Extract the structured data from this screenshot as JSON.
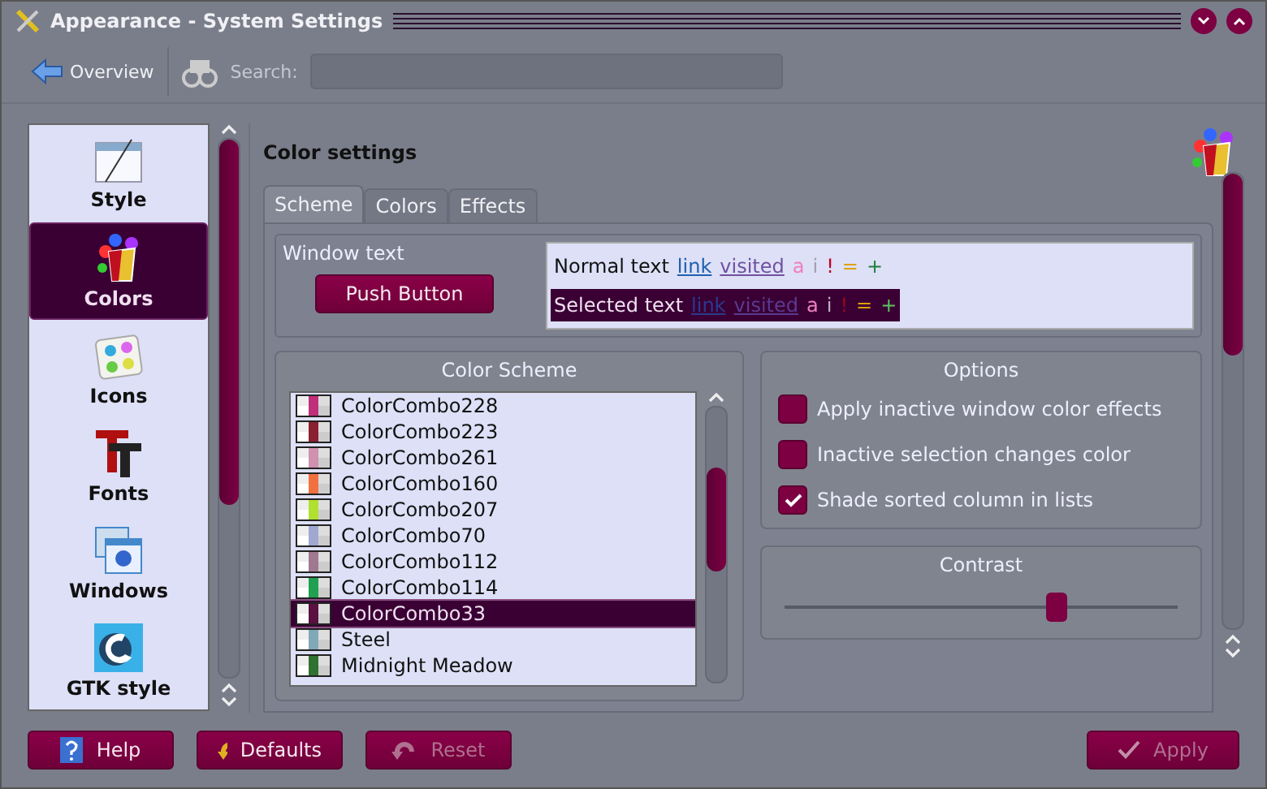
{
  "window": {
    "title": "Appearance - System Settings"
  },
  "toolbar": {
    "overview": "Overview",
    "search_label": "Search:"
  },
  "sidebar": {
    "items": [
      {
        "label": "Style",
        "selected": false
      },
      {
        "label": "Colors",
        "selected": true
      },
      {
        "label": "Icons",
        "selected": false
      },
      {
        "label": "Fonts",
        "selected": false
      },
      {
        "label": "Windows",
        "selected": false
      },
      {
        "label": "GTK style",
        "selected": false
      }
    ]
  },
  "page": {
    "title": "Color settings"
  },
  "tabs": [
    {
      "label": "Scheme",
      "selected": true
    },
    {
      "label": "Colors",
      "selected": false
    },
    {
      "label": "Effects",
      "selected": false
    }
  ],
  "preview": {
    "label": "Window text",
    "button": "Push Button",
    "rows": [
      {
        "kind": "normal",
        "tokens": [
          {
            "kind": "text",
            "text": "Normal text"
          },
          {
            "kind": "link",
            "text": "link"
          },
          {
            "kind": "visited",
            "text": "visited"
          },
          {
            "kind": "active",
            "text": "a"
          },
          {
            "kind": "inactive",
            "text": "i"
          },
          {
            "kind": "negative",
            "text": "!"
          },
          {
            "kind": "neutral",
            "text": "="
          },
          {
            "kind": "positive",
            "text": "+"
          }
        ]
      },
      {
        "kind": "selected",
        "tokens": [
          {
            "kind": "text",
            "text": "Selected text"
          },
          {
            "kind": "link",
            "text": "link"
          },
          {
            "kind": "visited",
            "text": "visited"
          },
          {
            "kind": "active",
            "text": "a"
          },
          {
            "kind": "inactive",
            "text": "i"
          },
          {
            "kind": "negative",
            "text": "!"
          },
          {
            "kind": "neutral",
            "text": "="
          },
          {
            "kind": "positive",
            "text": "+"
          }
        ]
      }
    ]
  },
  "color_scheme": {
    "title": "Color Scheme",
    "items": [
      {
        "name": "ColorCombo228",
        "color": "#c0307a",
        "selected": false
      },
      {
        "name": "ColorCombo223",
        "color": "#8a2030",
        "selected": false
      },
      {
        "name": "ColorCombo261",
        "color": "#d090b0",
        "selected": false
      },
      {
        "name": "ColorCombo160",
        "color": "#f07040",
        "selected": false
      },
      {
        "name": "ColorCombo207",
        "color": "#b0e030",
        "selected": false
      },
      {
        "name": "ColorCombo70",
        "color": "#a0a8d0",
        "selected": false
      },
      {
        "name": "ColorCombo112",
        "color": "#a07890",
        "selected": false
      },
      {
        "name": "ColorCombo114",
        "color": "#20a050",
        "selected": false
      },
      {
        "name": "ColorCombo33",
        "color": "#5a1040",
        "selected": true
      },
      {
        "name": "Steel",
        "color": "#80a8b8",
        "selected": false
      },
      {
        "name": "Midnight Meadow",
        "color": "#307030",
        "selected": false
      }
    ]
  },
  "options": {
    "title": "Options",
    "items": [
      {
        "label": "Apply inactive window color effects",
        "checked": false
      },
      {
        "label": "Inactive selection changes color",
        "checked": false
      },
      {
        "label": "Shade sorted column in lists",
        "checked": true
      }
    ]
  },
  "contrast": {
    "title": "Contrast",
    "level": 0.69
  },
  "buttons": [
    {
      "label": "Help",
      "disabled": false
    },
    {
      "label": "Defaults",
      "disabled": false
    },
    {
      "label": "Reset",
      "disabled": true
    },
    {
      "label": "Apply",
      "disabled": true
    }
  ]
}
